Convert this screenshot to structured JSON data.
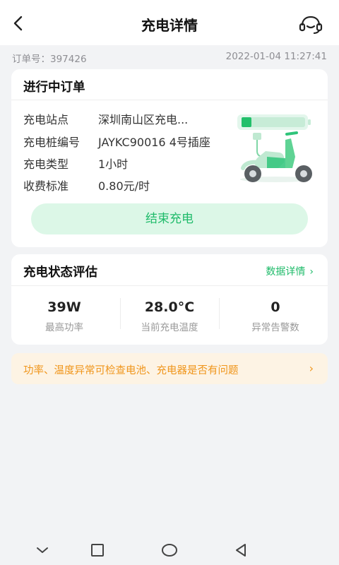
{
  "header": {
    "title": "充电详情",
    "back_icon": "back-arrow-icon",
    "service_icon": "customer-service-icon"
  },
  "order": {
    "id_label": "订单号：397426",
    "datetime": "2022-01-04 11:27:41"
  },
  "order_card": {
    "title": "进行中订单",
    "rows": [
      {
        "key": "充电站点",
        "value": "深圳南山区充电..."
      },
      {
        "key": "充电桩编号",
        "value": "JAYKC90016 4号插座"
      },
      {
        "key": "充电类型",
        "value": "1小时"
      },
      {
        "key": "收费标准",
        "value": "0.80元/时"
      }
    ],
    "end_button": "结束充电"
  },
  "status_card": {
    "title": "充电状态评估",
    "link": "数据详情",
    "stats": [
      {
        "value": "39W",
        "label": "最高功率"
      },
      {
        "value": "28.0°C",
        "label": "当前充电温度"
      },
      {
        "value": "0",
        "label": "异常告警数"
      }
    ]
  },
  "tip": {
    "text": "功率、温度异常可检查电池、充电器是否有问题"
  },
  "colors": {
    "accent": "#1fbb6a",
    "warning": "#f0951a",
    "background": "#f2f3f5"
  }
}
